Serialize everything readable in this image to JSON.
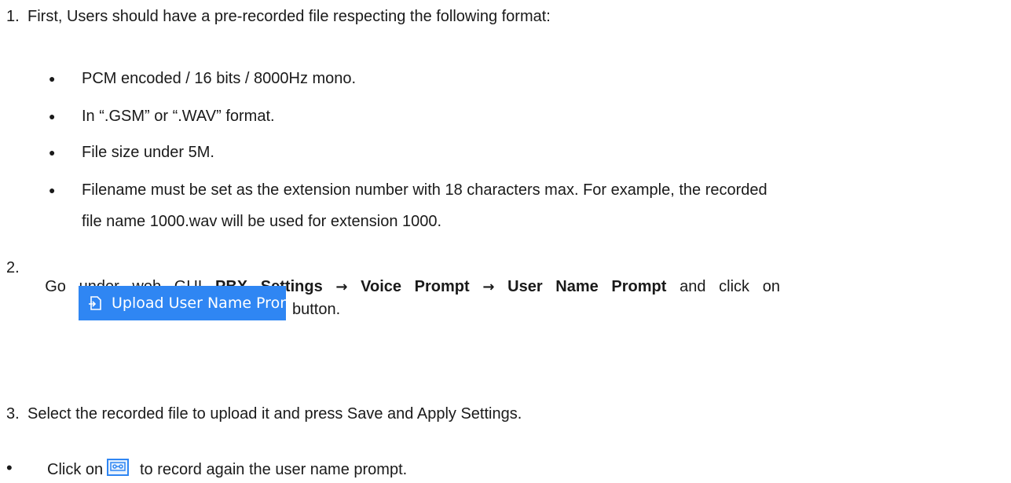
{
  "step1": {
    "number": "1.",
    "text": "First, Users should have a pre-recorded file respecting the following format:",
    "bullets": [
      "PCM encoded / 16 bits / 8000Hz mono.",
      "In “.GSM” or “.WAV” format.",
      "File size under 5M.",
      "Filename must be set as the extension number with 18 characters max. For example, the recorded",
      "file name 1000.wav will be used for extension 1000."
    ]
  },
  "step2": {
    "number": "2.",
    "go_under": "Go   under   web   GUI",
    "path1": "PBX   Settings",
    "arrow": "→",
    "path2": "Voice   Prompt",
    "path3": "User   Name   Prompt",
    "and_click_on": "and   click   on",
    "button_label": "Upload User Name Prompt",
    "button_suffix": "button.",
    "accent_color": "#2f86f3"
  },
  "step3": {
    "number": "3.",
    "text": "Select the recorded file to upload it and press Save and Apply Settings."
  },
  "note": {
    "bullet": "•",
    "prefix": "Click on",
    "icon": "cassette-record-icon",
    "suffix": "to record again the user name prompt."
  }
}
